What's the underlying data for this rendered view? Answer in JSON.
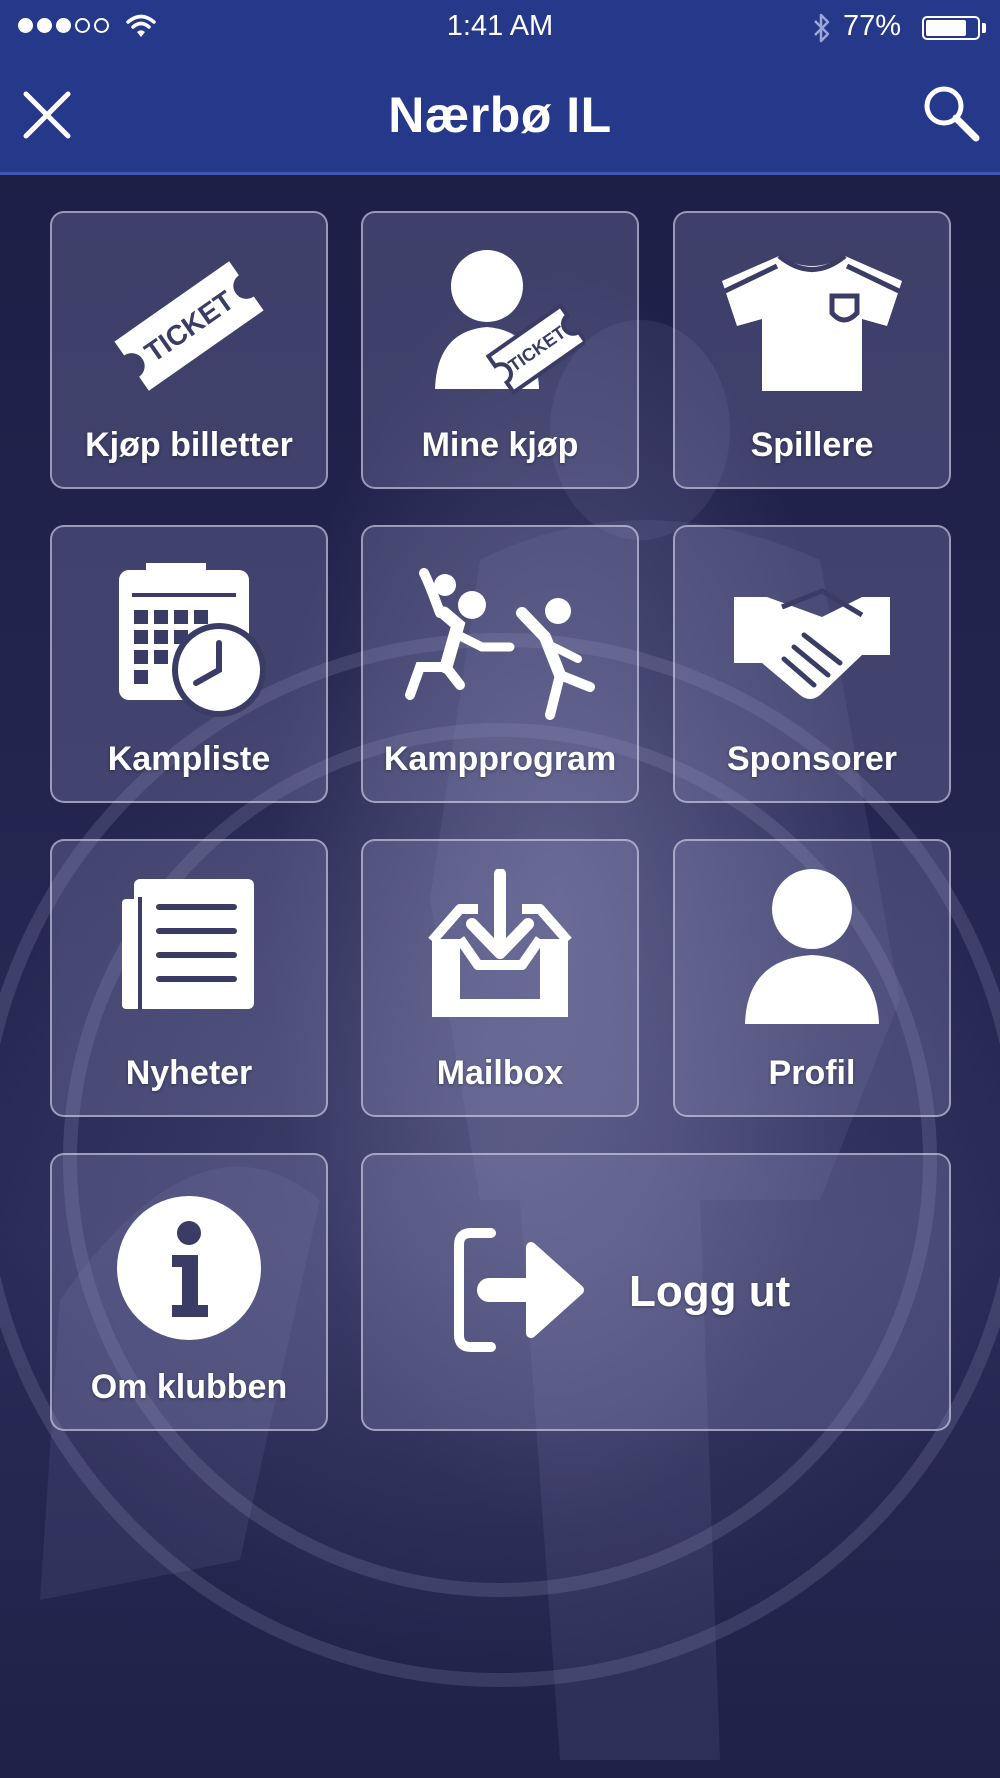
{
  "status_bar": {
    "time": "1:41 AM",
    "battery_percent": "77%",
    "battery_level": 0.77,
    "signal_bars": 3,
    "signal_total": 5,
    "icons": [
      "signal-dots-icon",
      "wifi-icon",
      "bluetooth-icon",
      "battery-icon"
    ]
  },
  "header": {
    "title": "Nærbø IL",
    "icons": [
      "close-icon",
      "search-icon"
    ]
  },
  "menu": {
    "items": [
      {
        "label": "Kjøp billetter",
        "icon": "ticket-icon",
        "ticket_text": "TICKET"
      },
      {
        "label": "Mine kjøp",
        "icon": "user-ticket-icon",
        "ticket_text": "TICKET"
      },
      {
        "label": "Spillere",
        "icon": "jersey-icon"
      },
      {
        "label": "Kampliste",
        "icon": "calendar-clock-icon"
      },
      {
        "label": "Kampprogram",
        "icon": "handball-players-icon"
      },
      {
        "label": "Sponsorer",
        "icon": "handshake-icon"
      },
      {
        "label": "Nyheter",
        "icon": "newspaper-icon"
      },
      {
        "label": "Mailbox",
        "icon": "inbox-download-icon"
      },
      {
        "label": "Profil",
        "icon": "person-icon"
      },
      {
        "label": "Om klubben",
        "icon": "info-icon"
      },
      {
        "label": "Logg ut",
        "icon": "logout-icon"
      }
    ]
  },
  "colors": {
    "header_bg": "#26388a",
    "tile_bg": "rgba(140,140,185,0.30)",
    "tile_border": "rgba(225,225,245,0.55)",
    "text": "#ffffff"
  }
}
